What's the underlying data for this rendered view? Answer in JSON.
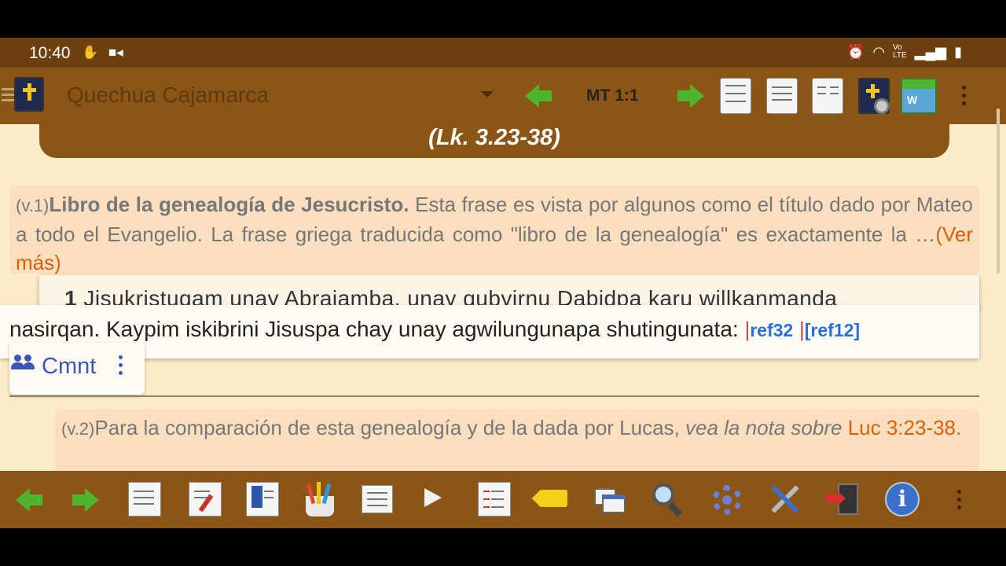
{
  "status_bar": {
    "time": "10:40",
    "left_icons": [
      "hand-icon",
      "camera-icon"
    ],
    "right_icons": [
      "alarm-icon",
      "wifi-icon",
      "lte-icon",
      "signal-icon",
      "battery-icon"
    ]
  },
  "toolbar": {
    "bible_name": "Quechua Cajamarca",
    "reference": "MT 1:1",
    "icons": [
      "bible-app-icon",
      "back-arrow-icon",
      "forward-arrow-icon",
      "reading-plan-icon",
      "linked-notes-icon",
      "parallel-view-icon",
      "add-settings-icon",
      "wiki-icon",
      "more-icon"
    ]
  },
  "content": {
    "section_heading": "(Lk. 3.23-38)",
    "note1": {
      "verse_tag": "(v.1)",
      "bold_text": "Libro de la genealogía de Jesucristo.",
      "text": " Esta frase es vista por algunos como el título dado por Mateo a todo el Evangelio. La frase griega traducida como \"libro de la genealogía\" es exactamente la …",
      "more_link": "(Ver más)"
    },
    "verse": {
      "number": "1",
      "line1": "Jisukristuqam unay Abrajamba, unay qubyirnu Dabidpa karu willkanmanda",
      "line2": "nasirqan. Kaypim iskibrini Jisuspa chay unay agwilungunapa shutingunata:",
      "ref_a": "ref32",
      "ref_b": "[ref12]",
      "separator": "|"
    },
    "comment_button": {
      "label": "Cmnt"
    },
    "note2": {
      "verse_tag": "(v.2)",
      "text": "Para la comparación de esta genealogía y de la dada por Lucas, ",
      "italic_text": "vea la nota sobre",
      "link_text": " Luc 3:23-38",
      "end": "."
    }
  },
  "bottom_bar": {
    "icons": [
      "back-arrow-icon",
      "forward-arrow-icon",
      "copy-icon",
      "edit-note-icon",
      "bookmark-icon",
      "highlight-icon",
      "journal-icon",
      "play-icon",
      "list-icon",
      "tag-icon",
      "windows-icon",
      "search-icon",
      "settings-gear-icon",
      "tools-icon",
      "exit-icon",
      "info-icon",
      "more-icon"
    ]
  },
  "colors": {
    "toolbar_brown": "#8a5515",
    "status_brown": "#6b3f0e",
    "page_background": "#fdecc8",
    "note_background": "#fbdfbf",
    "link_orange": "#d9600f",
    "ref_blue": "#2a6fd4",
    "cmnt_blue": "#3a56b8",
    "arrow_green": "#4fb52e"
  }
}
